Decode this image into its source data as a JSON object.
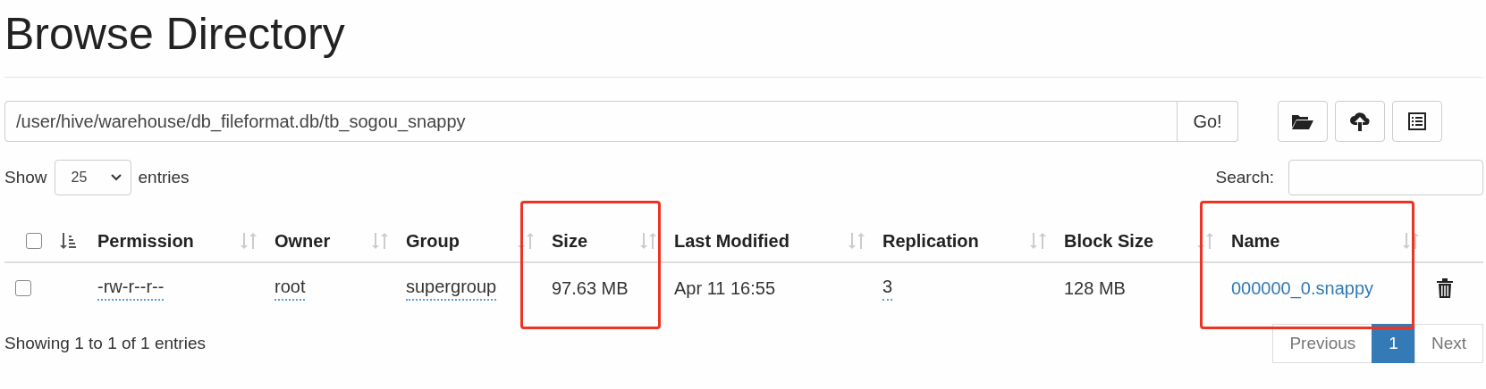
{
  "title": "Browse Directory",
  "path_field": {
    "value": "/user/hive/warehouse/db_fileformat.db/tb_sogou_snappy"
  },
  "go_button": "Go!",
  "toolbar_buttons": [
    {
      "kind": "folder"
    },
    {
      "kind": "upload"
    },
    {
      "kind": "list"
    }
  ],
  "length_menu": {
    "label_before": "Show",
    "value": "25",
    "label_after": "entries"
  },
  "search": {
    "label": "Search:"
  },
  "table": {
    "select_all": {
      "checked": false
    },
    "columns": [
      {
        "label": "Permission",
        "highlighted": false
      },
      {
        "label": "Owner",
        "highlighted": false
      },
      {
        "label": "Group",
        "highlighted": false
      },
      {
        "label": "Size",
        "highlighted": true
      },
      {
        "label": "Last Modified",
        "highlighted": false
      },
      {
        "label": "Replication",
        "highlighted": false
      },
      {
        "label": "Block Size",
        "highlighted": false
      },
      {
        "label": "Name",
        "highlighted": true
      }
    ],
    "rows": [
      {
        "checked": false,
        "cells": [
          {
            "text": "-rw-r--r--",
            "kind": "tooltip"
          },
          {
            "text": "root",
            "kind": "tooltip"
          },
          {
            "text": "supergroup",
            "kind": "tooltip"
          },
          {
            "text": "97.63 MB",
            "kind": "plain"
          },
          {
            "text": "Apr 11 16:55",
            "kind": "plain"
          },
          {
            "text": "3",
            "kind": "tooltip"
          },
          {
            "text": "128 MB",
            "kind": "plain"
          },
          {
            "text": "000000_0.snappy",
            "kind": "link"
          }
        ]
      }
    ]
  },
  "info": "Showing 1 to 1 of 1 entries",
  "pagination": [
    {
      "label": "Previous",
      "selected": false,
      "disabled": true
    },
    {
      "label": "1",
      "selected": true,
      "disabled": false
    },
    {
      "label": "Next",
      "selected": false,
      "disabled": true
    }
  ]
}
